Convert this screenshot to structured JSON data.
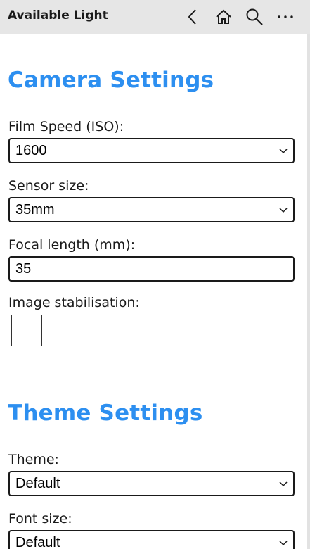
{
  "titlebar": {
    "title": "Available Light",
    "icons": [
      "back-icon",
      "home-icon",
      "search-icon",
      "more-icon"
    ]
  },
  "camera_settings": {
    "heading": "Camera Settings",
    "film_speed": {
      "label": "Film Speed (ISO):",
      "value": "1600"
    },
    "sensor_size": {
      "label": "Sensor size:",
      "value": "35mm"
    },
    "focal_length": {
      "label": "Focal length (mm):",
      "value": "35"
    },
    "image_stabilisation": {
      "label": "Image stabilisation:",
      "checked": false
    }
  },
  "theme_settings": {
    "heading": "Theme Settings",
    "theme": {
      "label": "Theme:",
      "value": "Default"
    },
    "font_size": {
      "label": "Font size:",
      "value": "Default"
    }
  },
  "colors": {
    "accent": "#2d8ff0",
    "titlebar_bg": "#e6e6e6",
    "border": "#1a1a1a"
  }
}
